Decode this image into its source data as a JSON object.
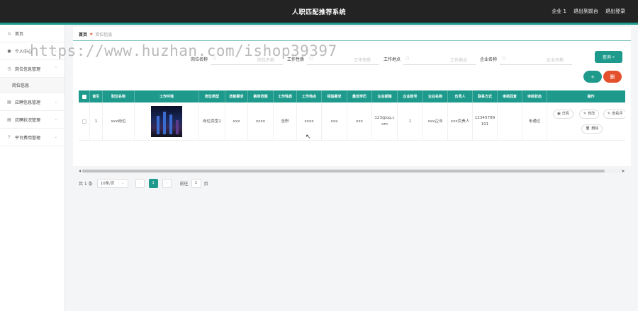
{
  "app": {
    "title": "人职匹配推荐系统"
  },
  "topbar": {
    "user_label": "企业 1",
    "backend_label": "退出到前台",
    "logout_label": "退出登录"
  },
  "sidebar": {
    "items": [
      {
        "label": "首页",
        "icon": "home-icon",
        "expandable": false
      },
      {
        "label": "个人中心",
        "icon": "user-icon",
        "expandable": true
      },
      {
        "label": "岗位信息管理",
        "icon": "clock-icon",
        "expandable": true,
        "expanded": true,
        "children": [
          {
            "label": "岗位信息"
          }
        ]
      },
      {
        "label": "应聘信息管理",
        "icon": "document-icon",
        "expandable": true
      },
      {
        "label": "应聘状况管理",
        "icon": "document-icon",
        "expandable": true
      },
      {
        "label": "平台费用管理",
        "icon": "help-icon",
        "expandable": true
      }
    ]
  },
  "breadcrumb": {
    "home": "首页",
    "current": "岗位信息"
  },
  "search": {
    "fields": [
      {
        "label": "岗位名称",
        "placeholder": "岗位名称"
      },
      {
        "label": "工作性质",
        "placeholder": "工作性质"
      },
      {
        "label": "工作地点",
        "placeholder": "工作地点"
      },
      {
        "label": "企业名称",
        "placeholder": "企业名称"
      }
    ],
    "query_label": "查询"
  },
  "toolbar": {
    "add_label": "+",
    "delete_label": "删"
  },
  "table": {
    "headers": [
      "索引",
      "职位名称",
      "工作环境",
      "岗位类型",
      "技能要求",
      "薪资范围",
      "工作性质",
      "工作地点",
      "经验要求",
      "最低学历",
      "企业邮箱",
      "企业账号",
      "企业名称",
      "负责人",
      "联系方式",
      "审核回复",
      "审核状态",
      "操作"
    ],
    "rows": [
      {
        "index": "1",
        "job_name": "xxx岗位",
        "job_type": "岗位类型2",
        "skills": "xxx",
        "salary": "xxxx",
        "nature": "全职",
        "location": "xxxx",
        "experience": "xxx",
        "education": "xxx",
        "email": "123@qq.com",
        "account": "1",
        "company": "xxx企业",
        "contact_person": "xxx负责人",
        "phone": "12345789101",
        "review_reply": "",
        "review_status": "未通过",
        "actions": {
          "detail": "详情",
          "edit": "修改",
          "view": "查看评",
          "delete": "删除"
        }
      }
    ]
  },
  "pagination": {
    "total": "共 1 条",
    "page_size": "10条/页",
    "current_page": "1",
    "goto_prefix": "前往",
    "goto_value": "1",
    "goto_suffix": "页"
  },
  "watermark": "https://www.huzhan.com/ishop39397",
  "colors": {
    "primary": "#1e9a8c",
    "danger": "#e4502c",
    "topbar": "#232323"
  }
}
